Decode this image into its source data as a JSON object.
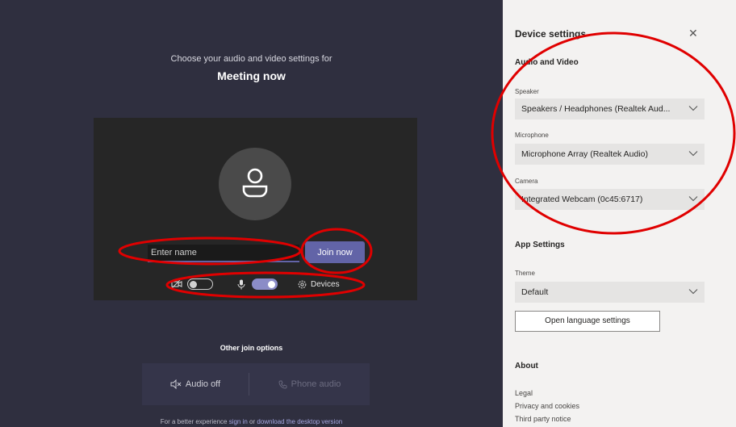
{
  "prejoin": {
    "subtitle": "Choose your audio and video settings for",
    "meeting_title": "Meeting now",
    "name_placeholder": "Enter name",
    "join_label": "Join now",
    "devices_label": "Devices",
    "camera_toggle": "off",
    "mic_toggle": "on"
  },
  "other_options": {
    "title": "Other join options",
    "audio_off": "Audio off",
    "phone_audio": "Phone audio"
  },
  "footer": {
    "text_before": "For a better experience ",
    "sign_in": "sign in",
    "middle": " or ",
    "download": "download the desktop version"
  },
  "settings": {
    "title": "Device settings",
    "audio_video_heading": "Audio and Video",
    "speaker_label": "Speaker",
    "speaker_value": "Speakers / Headphones (Realtek Aud...",
    "microphone_label": "Microphone",
    "microphone_value": "Microphone Array (Realtek Audio)",
    "camera_label": "Camera",
    "camera_value": "Integrated Webcam (0c45:6717)",
    "app_settings_heading": "App Settings",
    "theme_label": "Theme",
    "theme_value": "Default",
    "language_button": "Open language settings",
    "about_heading": "About",
    "about_links": [
      "Legal",
      "Privacy and cookies",
      "Third party notice"
    ]
  },
  "colors": {
    "accent": "#6264a7",
    "annotation": "#e00000",
    "left_bg": "#2f2f3f",
    "panel_bg": "#f3f2f1"
  },
  "icons": [
    "person-icon",
    "camera-off-icon",
    "microphone-icon",
    "gear-icon",
    "speaker-off-icon",
    "phone-icon",
    "close-icon",
    "chevron-down-icon"
  ]
}
